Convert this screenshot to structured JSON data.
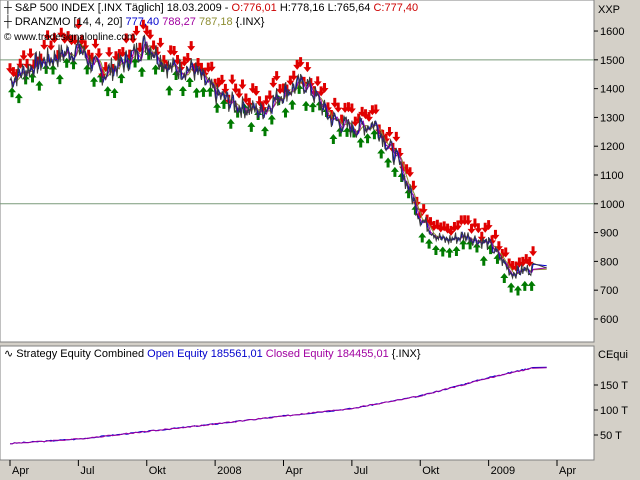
{
  "colors": {
    "panel_bg": "#ffffff",
    "frame_bg": "#d4d0c8",
    "price": "#3b3b3b",
    "ma_blue": "#0000cc",
    "ma_purple": "#a000a0",
    "ma_olive": "#8c8c30",
    "down_arrow": "#e00000",
    "up_arrow": "#007a00",
    "equity_open": "#0000cc",
    "equity_closed": "#a000a0",
    "text_red": "#cc0000",
    "text_blue": "#0000cc",
    "text_purple": "#a000a0",
    "text_olive": "#8c8c30"
  },
  "header": {
    "symbol": "S&P 500 INDEX [.INX  Täglich] 18.03.2009 - ",
    "open": "O:776,01",
    "high": "H:778,16",
    "low": "L:765,64",
    "close": "C:777,40",
    "indicator_label": "DRANZMO [14, 4, 20]",
    "ind_v1": "777,40",
    "ind_v2": "788,27",
    "ind_v3": "787,18",
    "ind_suffix": "{.INX}",
    "website": "© www.tradesignalonline.com",
    "corner_label": "XXP"
  },
  "equity_header": {
    "title": "Strategy Equity Combined",
    "open_equity": "Open Equity 185561,01",
    "closed_equity": "Closed Equity 184455,01",
    "suffix": "{.INX}",
    "corner_label": "CEqui"
  },
  "x_axis_labels": [
    "Apr",
    "Jul",
    "Okt",
    "2008",
    "Apr",
    "Jul",
    "Okt",
    "2009",
    "Apr"
  ],
  "chart_data": [
    {
      "type": "line",
      "title": "S&P 500 INDEX [.INX Täglich]",
      "x": [
        "2007-04",
        "2007-05",
        "2007-06",
        "2007-07",
        "2007-08",
        "2007-09",
        "2007-10",
        "2007-11",
        "2007-12",
        "2008-01",
        "2008-02",
        "2008-03",
        "2008-04",
        "2008-05",
        "2008-06",
        "2008-07",
        "2008-08",
        "2008-09",
        "2008-10",
        "2008-11",
        "2008-12",
        "2009-01",
        "2009-02",
        "2009-03"
      ],
      "series": [
        {
          "values": [
            1430,
            1480,
            1510,
            1540,
            1450,
            1490,
            1560,
            1470,
            1470,
            1380,
            1340,
            1320,
            1390,
            1420,
            1300,
            1260,
            1280,
            1150,
            950,
            870,
            890,
            860,
            760,
            777
          ]
        }
      ],
      "ylim": [
        520,
        1680
      ],
      "yticks": [
        600,
        700,
        800,
        900,
        1000,
        1100,
        1200,
        1300,
        1400,
        1500,
        1600
      ]
    },
    {
      "type": "line",
      "title": "Strategy Equity Combined",
      "x": [
        "2007-04",
        "2007-07",
        "2007-10",
        "2008-01",
        "2008-04",
        "2008-07",
        "2008-10",
        "2009-01",
        "2009-03"
      ],
      "series": [
        {
          "name": "Open Equity",
          "values": [
            33000,
            42000,
            57000,
            72000,
            88000,
            103000,
            128000,
            165000,
            185561
          ]
        },
        {
          "name": "Closed Equity",
          "values": [
            33000,
            42000,
            57000,
            72000,
            88000,
            103000,
            128000,
            164000,
            184455
          ]
        }
      ],
      "ylim": [
        0,
        200000
      ],
      "ytick_labels": [
        "50 T",
        "100 T",
        "150 T"
      ],
      "yticks": [
        50000,
        100000,
        150000
      ]
    }
  ]
}
